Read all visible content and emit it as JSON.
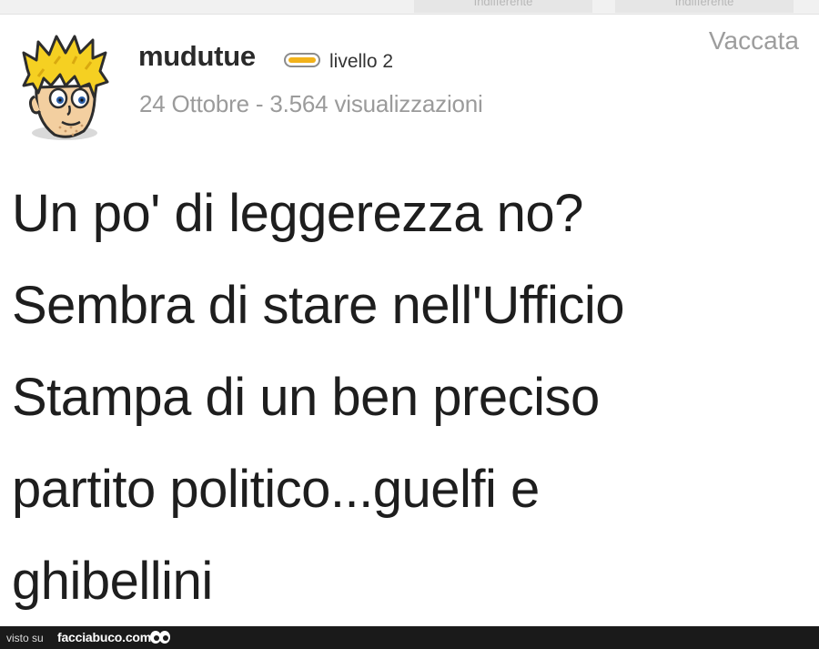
{
  "top_tabs": [
    "Indifferente",
    "Indifferente"
  ],
  "post": {
    "username": "mudutue",
    "level": "livello 2",
    "meta": "24 Ottobre - 3.564 visualizzazioni",
    "verdict": "Vaccata",
    "text": "Un po' di leggerezza no?\nSembra di stare nell'Ufficio\nStampa di un ben preciso\npartito politico...guelfi e\nghibellini"
  },
  "colors": {
    "level_badge": "#f2b21a",
    "meta_text": "#9b9b9b",
    "footer_bg": "#1a1a1a"
  },
  "footer": {
    "prefix": "visto su",
    "brand": "facciabuco.com",
    "logo_icon": "eyes-icon"
  }
}
